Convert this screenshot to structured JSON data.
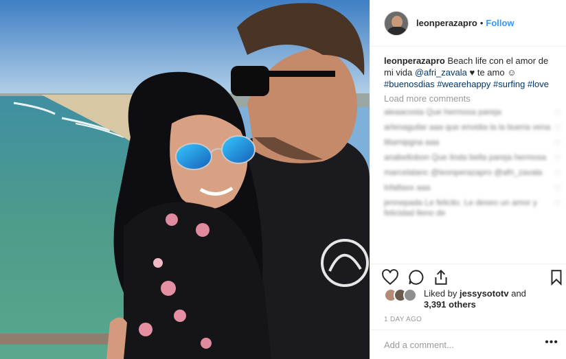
{
  "header": {
    "username": "leonperazapro",
    "separator": "•",
    "follow_label": "Follow"
  },
  "caption": {
    "username": "leonperazapro",
    "text_1": "Beach life con el amor de mi vida",
    "mention": "@afri_zavala",
    "text_2": "♥ te amo ☺",
    "hashtags": [
      "#buenosdias",
      "#wearehappy",
      "#surfing",
      "#love"
    ]
  },
  "load_more_label": "Load more comments",
  "comments": [
    "aleaacosta Que hermosa pareja",
    "arlenaguilar aaa que envidia la la buena vena",
    "liliamipgna aaa",
    "anabeltobon Que linda bella pareja hermosa",
    "marcelalanc @leonperazapro @afri_zavala",
    "lofaltaxx aaa",
    "jennepada Le felicito. Le deseo un amor y felicidad lleno de"
  ],
  "actions": {
    "like_icon": "heart-outline-icon",
    "comment_icon": "comment-bubble-icon",
    "share_icon": "share-upload-icon",
    "save_icon": "bookmark-icon"
  },
  "likes": {
    "prefix": "Liked by",
    "user": "jessysototv",
    "joiner": "and",
    "others": "3,391 others"
  },
  "timestamp": "1 DAY AGO",
  "add_comment": {
    "placeholder": "Add a comment...",
    "more_label": "•••"
  },
  "colors": {
    "link": "#003569",
    "follow": "#3897f0",
    "muted": "#999999",
    "text": "#262626",
    "border": "#efefef"
  }
}
